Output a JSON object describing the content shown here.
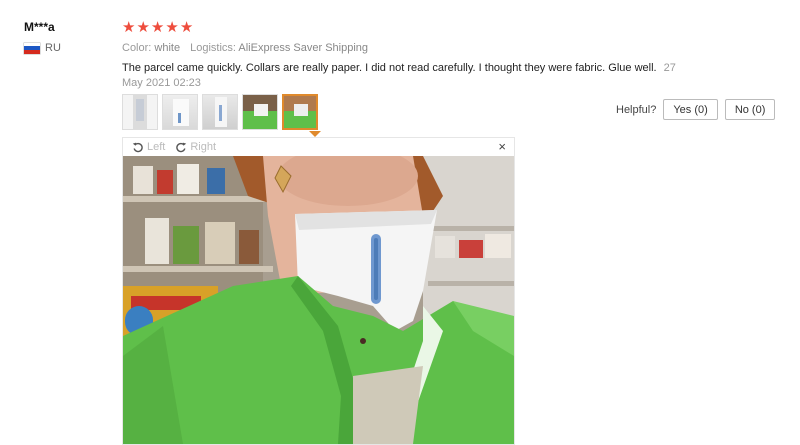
{
  "reviewer": {
    "name": "M***a",
    "country": "RU"
  },
  "review": {
    "rating": 5,
    "color_label": "Color:",
    "color_value": "white",
    "logistics_label": "Logistics:",
    "logistics_value": "AliExpress Saver Shipping",
    "text": "The parcel came quickly. Collars are really paper. I did not read carefully. I thought they were fabric. Glue well.",
    "date": "27 May 2021 02:23"
  },
  "helpful": {
    "label": "Helpful?",
    "yes": "Yes (0)",
    "no": "No (0)"
  },
  "viewer": {
    "rotate_left": "Left",
    "rotate_right": "Right",
    "close": "×"
  },
  "colors": {
    "star": "#ee4d3d",
    "active_thumb": "#e08a2c",
    "uniform_green": "#5fbf4a"
  },
  "thumbnails_count": 5,
  "active_thumbnail": 5
}
